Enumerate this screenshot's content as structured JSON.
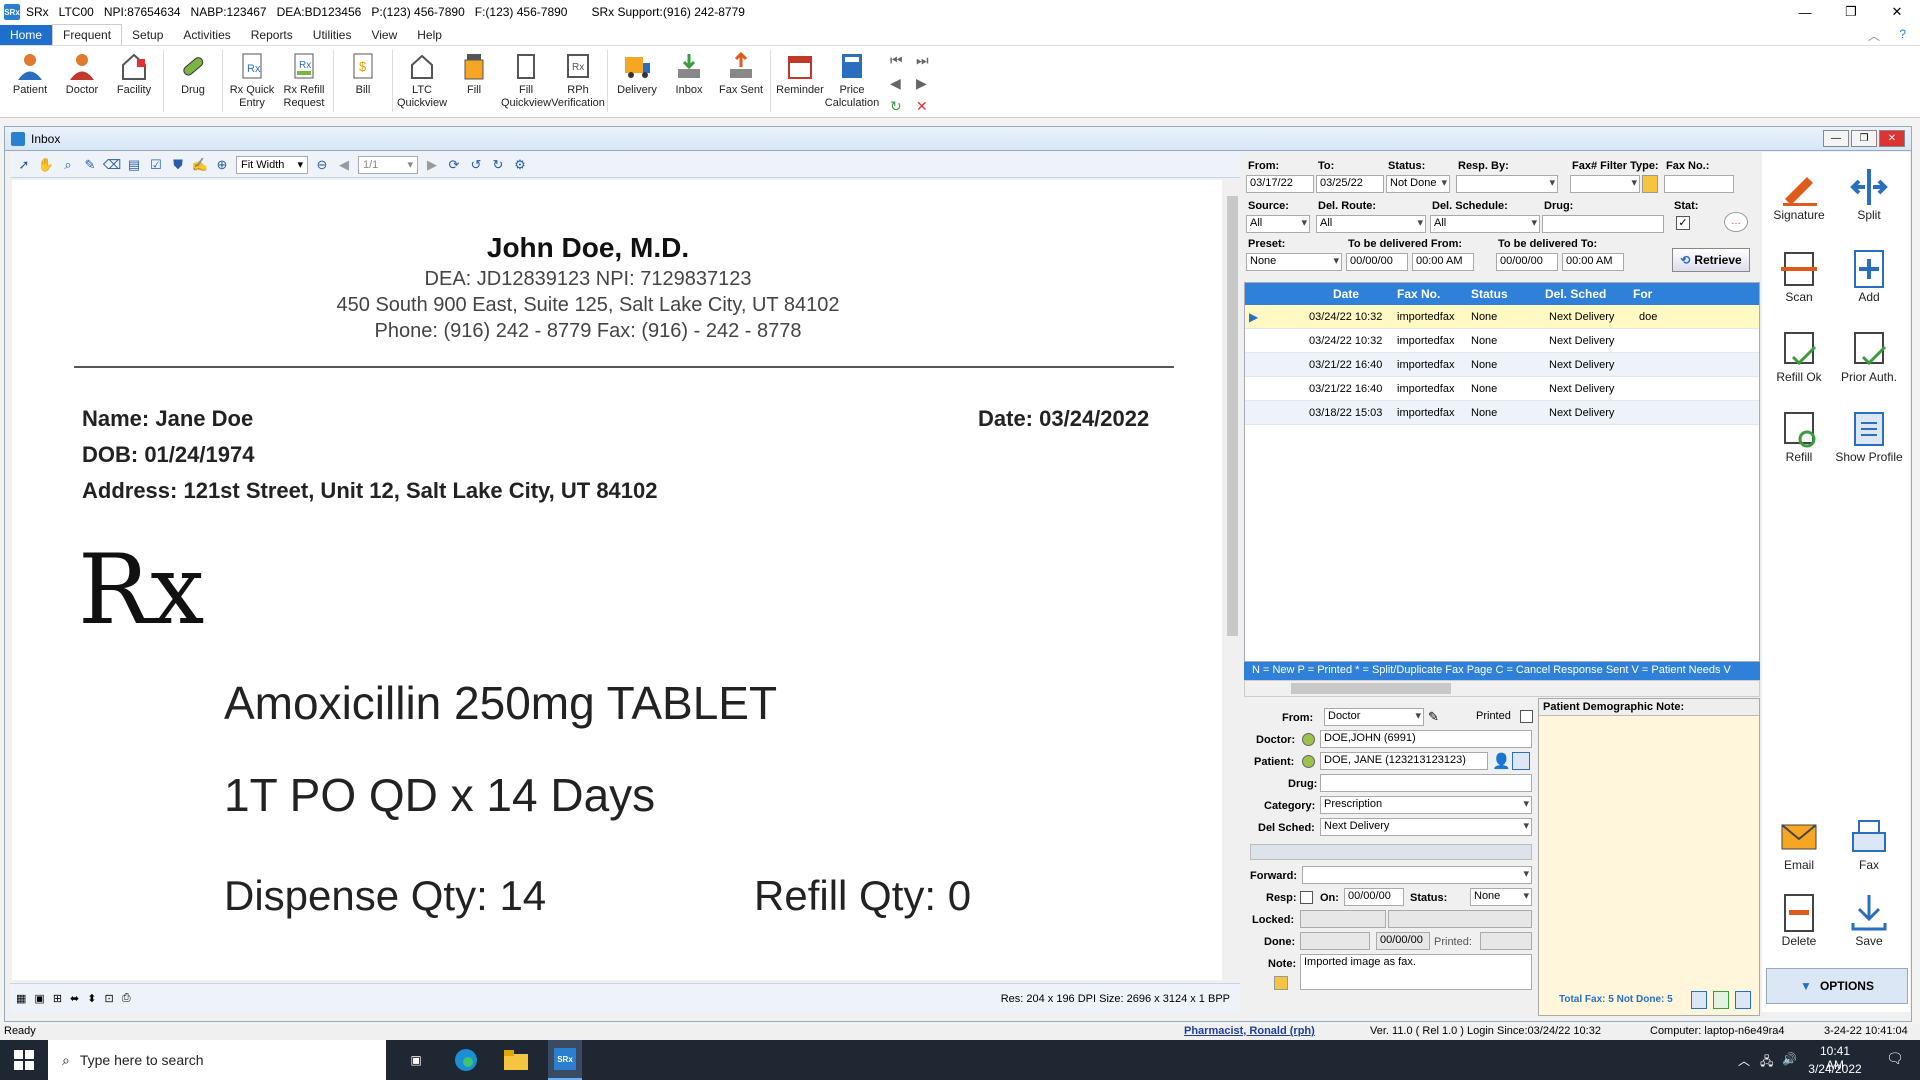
{
  "titlebar": {
    "app": "SRx",
    "store": "LTC00",
    "npi": "NPI:87654634",
    "nabp": "NABP:123467",
    "dea": "DEA:BD123456",
    "phone": "P:(123) 456-7890",
    "fax": "F:(123) 456-7890",
    "support": "SRx Support:(916) 242-8779"
  },
  "menu": [
    "Home",
    "Frequent",
    "Setup",
    "Activities",
    "Reports",
    "Utilities",
    "View",
    "Help"
  ],
  "ribbon": {
    "patient": "Patient",
    "doctor": "Doctor",
    "facility": "Facility",
    "drug": "Drug",
    "rx_quick": "Rx Quick Entry",
    "rx_refill": "Rx Refill Request",
    "bill": "Bill",
    "ltc": "LTC Quickview",
    "fill": "Fill",
    "fill_quick": "Fill Quickview",
    "rph": "RPh Verification",
    "delivery": "Delivery",
    "inbox": "Inbox",
    "fax_sent": "Fax Sent",
    "reminder": "Reminder",
    "price": "Price Calculation"
  },
  "inbox": {
    "title": "Inbox"
  },
  "viewer": {
    "zoom": "Fit Width",
    "page": "1/1",
    "res": "Res:  204 x 196 DPI   Size:  2696 x 3124 x 1 BPP"
  },
  "doc": {
    "doctor": "John Doe, M.D.",
    "dea_npi": "DEA: JD12839123    NPI: 7129837123",
    "address": "450 South 900 East, Suite 125, Salt Lake City, UT 84102",
    "phone": "Phone: (916) 242 - 8779    Fax: (916) - 242 - 8778",
    "name": "Name: Jane Doe",
    "date": "Date: 03/24/2022",
    "dob": "DOB: 01/24/1974",
    "paddr": "Address: 121st Street, Unit 12, Salt Lake City, UT 84102",
    "rx": "Rx",
    "drug": "Amoxicillin 250mg TABLET",
    "sig": "1T PO QD x 14 Days",
    "dispense": "Dispense Qty: 14",
    "refill": "Refill Qty: 0"
  },
  "filters": {
    "from_l": "From:",
    "from": "03/17/22",
    "to_l": "To:",
    "to": "03/25/22",
    "status_l": "Status:",
    "status": "Not Done",
    "resp_l": "Resp. By:",
    "faxfilter_l": "Fax# Filter Type:",
    "faxno_l": "Fax No.:",
    "source_l": "Source:",
    "source": "All",
    "route_l": "Del. Route:",
    "route": "All",
    "sched_l": "Del. Schedule:",
    "sched": "All",
    "drug_l": "Drug:",
    "stat_l": "Stat:",
    "preset_l": "Preset:",
    "preset": "None",
    "tbd_from_l": "To be delivered From:",
    "tbd_from_d": "00/00/00",
    "tbd_from_t": "00:00 AM",
    "tbd_to_l": "To be delivered To:",
    "tbd_to_d": "00/00/00",
    "tbd_to_t": "00:00 AM",
    "retrieve": "Retrieve"
  },
  "grid": {
    "headers": [
      "Date",
      "Fax No.",
      "Status",
      "Del. Sched",
      "For"
    ],
    "rows": [
      {
        "date": "03/24/22  10:32",
        "fax": "importedfax",
        "status": "None",
        "sched": "Next Delivery",
        "for": "doe"
      },
      {
        "date": "03/24/22  10:32",
        "fax": "importedfax",
        "status": "None",
        "sched": "Next Delivery",
        "for": ""
      },
      {
        "date": "03/21/22  16:40",
        "fax": "importedfax",
        "status": "None",
        "sched": "Next Delivery",
        "for": ""
      },
      {
        "date": "03/21/22  16:40",
        "fax": "importedfax",
        "status": "None",
        "sched": "Next Delivery",
        "for": ""
      },
      {
        "date": "03/18/22  15:03",
        "fax": "importedfax",
        "status": "None",
        "sched": "Next Delivery",
        "for": ""
      }
    ],
    "legend": "N = New     P = Printed     * = Split/Duplicate Fax Page     C = Cancel Response Sent     V = Patient Needs V"
  },
  "detail": {
    "from_l": "From:",
    "from": "Doctor",
    "printed_l": "Printed",
    "doctor_l": "Doctor:",
    "doctor": "DOE,JOHN (6991)",
    "patient_l": "Patient:",
    "patient": "DOE, JANE  (123213123123)",
    "drug_l": "Drug:",
    "category_l": "Category:",
    "category": "Prescription",
    "delsched_l": "Del Sched:",
    "delsched": "Next Delivery",
    "forward_l": "Forward:",
    "resp_l": "Resp:",
    "on_l": "On:",
    "on": "00/00/00",
    "status_l": "Status:",
    "status": "None",
    "locked_l": "Locked:",
    "done_l": "Done:",
    "done_date": "00/00/00",
    "dprinted_l": "Printed:",
    "note_l": "Note:",
    "note": "Imported image as fax."
  },
  "demo": {
    "title": "Patient Demographic Note:",
    "total": "Total Fax: 5 Not Done: 5"
  },
  "side": {
    "signature": "Signature",
    "split": "Split",
    "scan": "Scan",
    "add": "Add",
    "refill_ok": "Refill Ok",
    "prior": "Prior Auth.",
    "refill": "Refill",
    "show_profile": "Show Profile",
    "email": "Email",
    "fax": "Fax",
    "delete": "Delete",
    "save": "Save",
    "options": "OPTIONS"
  },
  "statusbar": {
    "ready": "Ready",
    "pharmacist": "Pharmacist, Ronald (rph)",
    "ver": "Ver. 11.0 ( Rel 1.0 )   Login Since:03/24/22 10:32",
    "computer": "Computer: laptop-n6e49ra4",
    "clock": "3-24-22 10:41:04"
  },
  "taskbar": {
    "search": "Type here to search",
    "time": "10:41 AM",
    "date": "3/24/2022"
  },
  "colors": {
    "accent": "#2f80d8",
    "home_tab": "#1e6fc9",
    "selected_row": "#fff9c4",
    "taskbar": "#1f2733"
  }
}
